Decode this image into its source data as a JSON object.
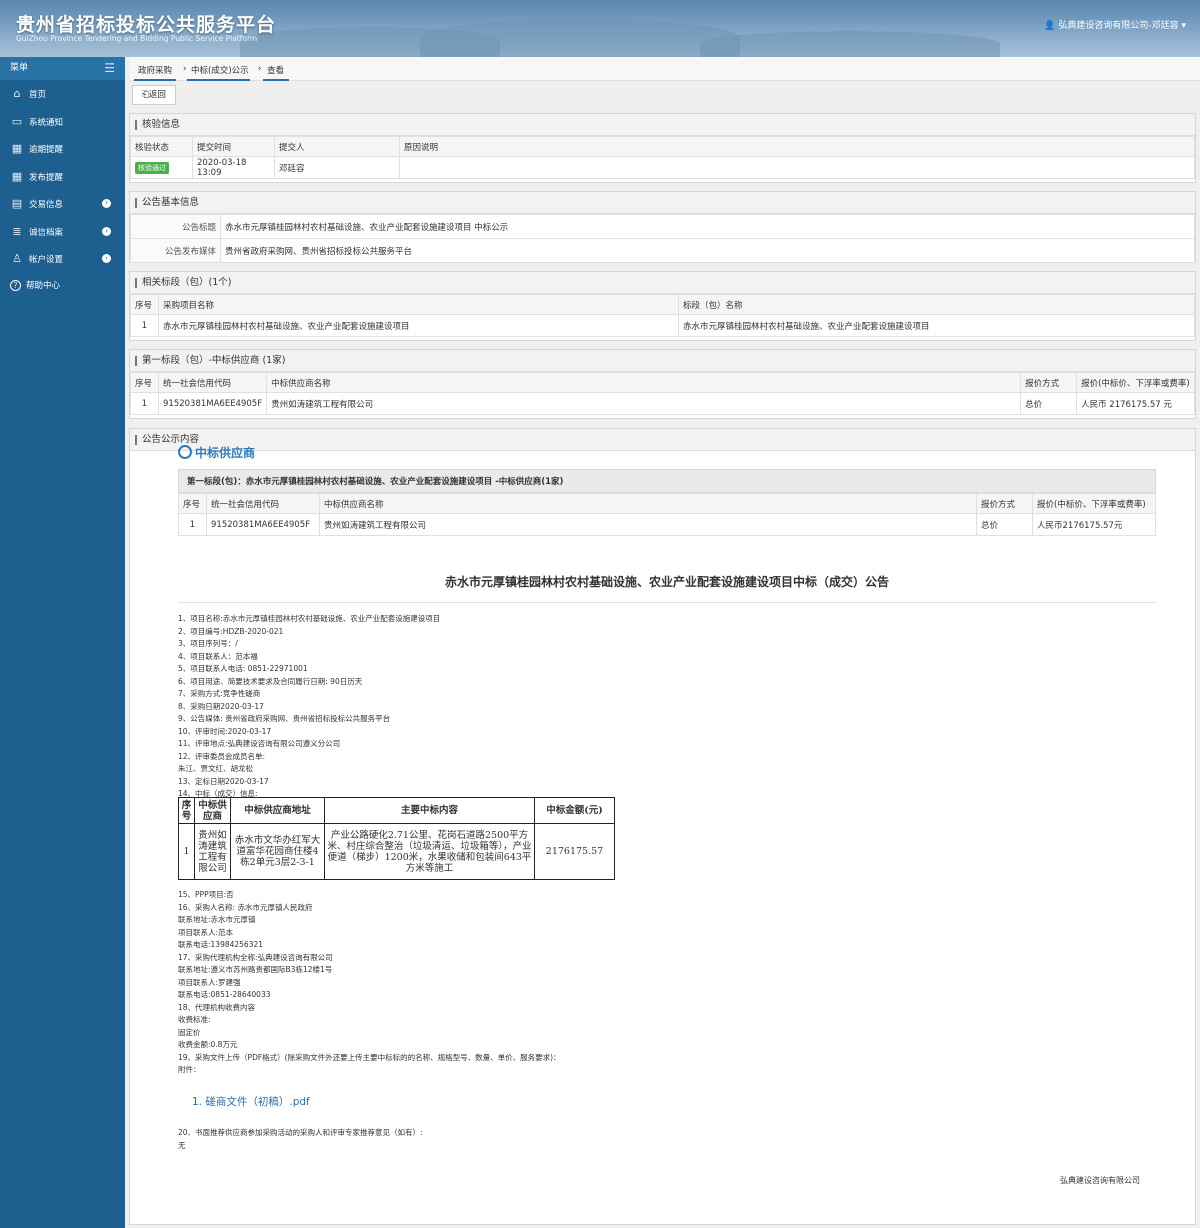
{
  "header": {
    "title": "贵州省招标投标公共服务平台",
    "subtitle": "GuiZhou Province Tendering and Bidding Public Service Platform",
    "user": "弘典建设咨询有限公司-邓廷容"
  },
  "sidebar": {
    "menu_label": "菜单",
    "items": [
      {
        "label": "首页",
        "icon": "home-icon",
        "arrow": false
      },
      {
        "label": "系统通知",
        "icon": "monitor-icon",
        "arrow": false
      },
      {
        "label": "逾期提醒",
        "icon": "calendar-icon",
        "arrow": false
      },
      {
        "label": "发布提醒",
        "icon": "calendar-icon",
        "arrow": false
      },
      {
        "label": "交易信息",
        "icon": "folder-icon",
        "arrow": true
      },
      {
        "label": "诚信档案",
        "icon": "document-icon",
        "arrow": true
      },
      {
        "label": "帐户设置",
        "icon": "user-icon",
        "arrow": true
      },
      {
        "label": "帮助中心",
        "icon": "help-icon",
        "arrow": false
      }
    ]
  },
  "breadcrumb": [
    "政府采购",
    "中标(成交)公示",
    "查看"
  ],
  "back_label": "返回",
  "verify": {
    "title": "核验信息",
    "headers": [
      "核验状态",
      "提交时间",
      "提交人",
      "原因说明"
    ],
    "status": "核验通过",
    "time": "2020-03-18 13:09",
    "person": "邓廷容",
    "reason": ""
  },
  "basic": {
    "title": "公告基本信息",
    "rows": [
      {
        "label": "公告标题",
        "value": "赤水市元厚镇桂园林村农村基础设施、农业产业配套设施建设项目 中标公示"
      },
      {
        "label": "公告发布媒体",
        "value": "贵州省政府采购网、贵州省招标投标公共服务平台"
      }
    ]
  },
  "sections": {
    "title": "相关标段（包）(1个)",
    "headers": [
      "序号",
      "采购项目名称",
      "标段（包）名称"
    ],
    "row": [
      "1",
      "赤水市元厚镇桂园林村农村基础设施、农业产业配套设施建设项目",
      "赤水市元厚镇桂园林村农村基础设施、农业产业配套设施建设项目"
    ]
  },
  "winners": {
    "title": "第一标段（包）-中标供应商 (1家)",
    "headers": [
      "序号",
      "统一社会信用代码",
      "中标供应商名称",
      "报价方式",
      "报价(中标价、下浮率或费率)"
    ],
    "row": [
      "1",
      "91520381MA6EE4905F",
      "贵州如涛建筑工程有限公司",
      "总价",
      "人民币 2176175.57 元"
    ]
  },
  "content": {
    "title": "公告公示内容",
    "winner_head": "中标供应商",
    "inner_title": "第一标段(包)：赤水市元厚镇桂园林村农村基础设施、农业产业配套设施建设项目 -中标供应商(1家)",
    "inner_headers": [
      "序号",
      "统一社会信用代码",
      "中标供应商名称",
      "报价方式",
      "报价(中标价、下浮率或费率)"
    ],
    "inner_row": [
      "1",
      "91520381MA6EE4905F",
      "贵州如涛建筑工程有限公司",
      "总价",
      "人民币2176175.57元"
    ],
    "announce_title": "赤水市元厚镇桂园林村农村基础设施、农业产业配套设施建设项目中标（成交）公告",
    "lines": [
      "1、项目名称:赤水市元厚镇桂园林村农村基础设施、农业产业配套设施建设项目",
      "2、项目编号:HDZB-2020-021",
      "3、项目序列号：/",
      "4、项目联系人：范本福",
      "5、项目联系人电话: 0851-22971001",
      "6、项目用途、简要技术要求及合同履行日期: 90日历天",
      "7、采购方式:竞争性磋商",
      "8、采购日期2020-03-17",
      "9、公告媒体: 贵州省政府采购网、贵州省招标投标公共服务平台",
      "10、评审时间:2020-03-17",
      "11、评审地点:弘典建设咨询有限公司遵义分公司",
      "12、评审委员会成员名单:",
      "朱江、贾文红、胡龙松",
      "13、定标日期2020-03-17",
      "14、中标（成交）信息:"
    ],
    "bid_table": {
      "headers": [
        "序号",
        "中标供应商",
        "中标供应商地址",
        "主要中标内容",
        "中标金额(元)"
      ],
      "row": [
        "1",
        "贵州如涛建筑工程有限公司",
        "赤水市文华办红军大道富华花园商住楼4栋2单元3层2-3-1",
        "产业公路硬化2.71公里、花岗石道路2500平方米、村庄综合整治（垃圾清运、垃圾箱等），产业便道（梯步）1200米，水果收储和包装间643平方米等施工",
        "2176175.57"
      ]
    },
    "tail_lines": [
      "15、PPP项目:否",
      "16、采购人名称: 赤水市元厚镇人民政府",
      "联系地址:赤水市元厚镇",
      "项目联系人:范本",
      "联系电话:13984256321",
      "17、采购代理机构全称:弘典建设咨询有限公司",
      "联系地址:遵义市苏州路贵都国际B3栋12楼1号",
      "项目联系人:罗建强",
      "联系电话:0851-28640033",
      "18、代理机构收费内容",
      "收费标准:",
      "固定价",
      "收费金额:0.8万元",
      "19、采购文件上传（PDF格式）(除采购文件外还要上传主要中标标的的名称、规格型号、数量、单价、服务要求)：",
      "附件："
    ],
    "attachment": "磋商文件（初稿）.pdf",
    "tail2": [
      "20、书面推荐供应商参加采购活动的采购人和评审专家推荐意见（如有）:",
      "无"
    ],
    "signature": "弘典建设咨询有限公司"
  }
}
